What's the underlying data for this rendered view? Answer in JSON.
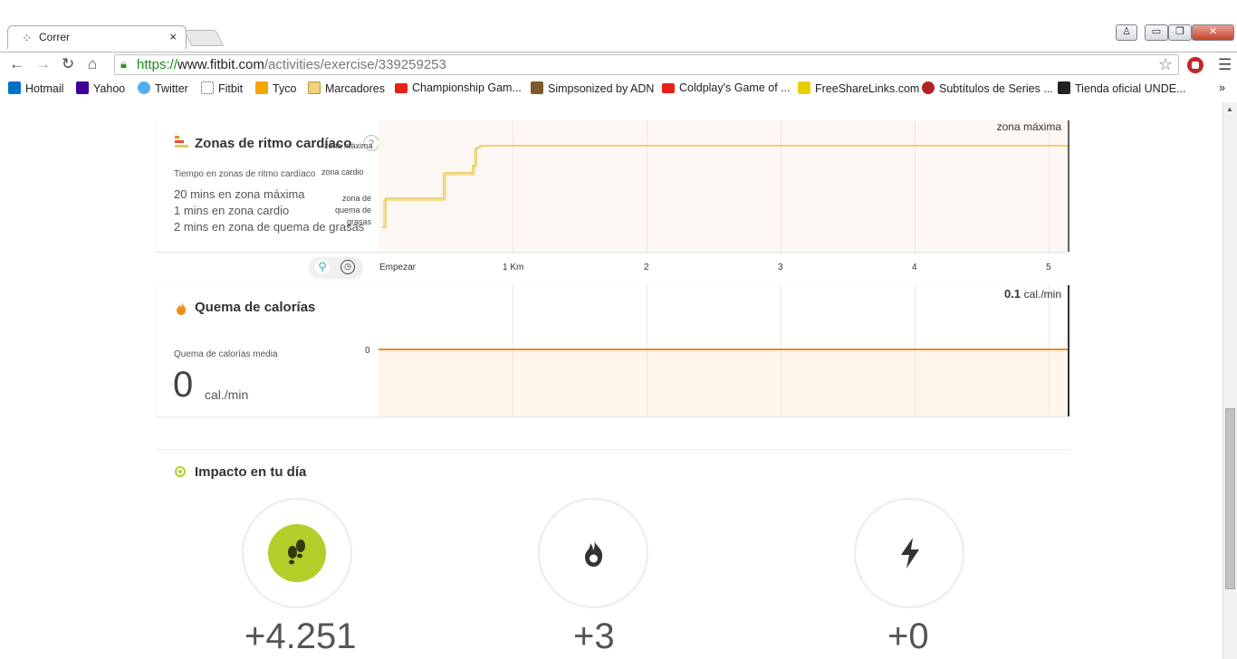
{
  "browser": {
    "tab_title": "Correr",
    "tab_favicon": "fitbit-logo",
    "tab_close": "×",
    "url_scheme": "https://",
    "url_host": "www.fitbit.com",
    "url_path": "/activities/exercise/339259253",
    "bookmarks": [
      {
        "label": "Hotmail",
        "icon": "outlook-icon",
        "color": "#0072c6"
      },
      {
        "label": "Yahoo",
        "icon": "yahoo-icon",
        "color": "#410093"
      },
      {
        "label": "Twitter",
        "icon": "twitter-icon",
        "color": "#55acee"
      },
      {
        "label": "Fitbit",
        "icon": "fitbit-icon",
        "color": "#4a4a4a"
      },
      {
        "label": "Tyco",
        "icon": "tyco-icon",
        "color": "#f5a500"
      },
      {
        "label": "Marcadores",
        "icon": "folder-icon",
        "color": "#f1d27a"
      },
      {
        "label": "Championship Gam...",
        "icon": "youtube-icon",
        "color": "#e62117"
      },
      {
        "label": "Simpsonized by ADN",
        "icon": "simpson-icon",
        "color": "#7d5a2e"
      },
      {
        "label": "Coldplay's Game of ...",
        "icon": "youtube-icon",
        "color": "#e62117"
      },
      {
        "label": "FreeShareLinks.com",
        "icon": "fsl-icon",
        "color": "#e8d000"
      },
      {
        "label": "Subtítulos de Series ...",
        "icon": "tv-icon",
        "color": "#b22222"
      },
      {
        "label": "Tienda oficial UNDE...",
        "icon": "store-icon",
        "color": "#222222"
      }
    ],
    "bookmarks_more": "»"
  },
  "heart_zones": {
    "title": "Zonas de ritmo cardíaco",
    "help": "?",
    "subtitle": "Tiempo en zonas de ritmo cardíaco",
    "rows": [
      "20 mins en zona máxima",
      "1 mins en zona cardio",
      "2 mins en zona de quema de grasas"
    ],
    "y_labels": [
      "zona máxima",
      "zona cardio",
      "zona de quema de grasas"
    ],
    "top_right_label": "zona máxima",
    "line_color": "#e7c84b",
    "fill_color": "#fdf7f4"
  },
  "x_axis": {
    "labels": [
      "Empezar",
      "1 Km",
      "2",
      "3",
      "4",
      "5"
    ],
    "toggle_icons": [
      "map-pin-icon",
      "clock-icon"
    ]
  },
  "calories": {
    "title": "Quema de calorías",
    "subtitle": "Quema de calorías media",
    "value": "0",
    "unit": "cal./min",
    "max_value": "0.1",
    "max_unit": "cal./min",
    "y_zero_label": "0",
    "line_color": "#f08c1e",
    "fill_color": "#fff5ea"
  },
  "impact": {
    "title": "Impacto en tu día",
    "items": [
      {
        "value": "+4.251",
        "icon": "footsteps-icon",
        "accent": "#b4cd29"
      },
      {
        "value": "+3",
        "icon": "flame-icon",
        "accent": "#333333"
      },
      {
        "value": "+0",
        "icon": "lightning-icon",
        "accent": "#333333"
      }
    ]
  }
}
